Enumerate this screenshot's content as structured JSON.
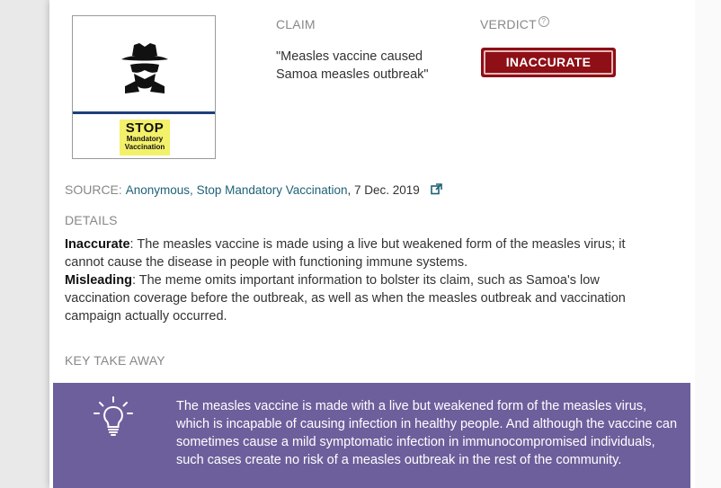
{
  "image": {
    "stop_word": "STOP",
    "stop_line1": "Mandatory",
    "stop_line2": "Vaccination",
    "icon": "spy-icon"
  },
  "claim": {
    "label": "CLAIM",
    "text": "\"Measles vaccine caused Samoa measles outbreak\""
  },
  "verdict": {
    "label": "VERDICT",
    "help_icon": "?",
    "value": "INACCURATE",
    "color": "#8e0f16"
  },
  "source": {
    "label": "SOURCE:",
    "link1": "Anonymous",
    "separator": ",",
    "link2": "Stop Mandatory Vaccination",
    "date": ", 7 Dec. 2019"
  },
  "details": {
    "label": "DETAILS",
    "items": [
      {
        "term": "Inaccurate",
        "text": ": The measles vaccine is made using a live but weakened form of the measles virus; it cannot cause the disease in people with functioning immune systems."
      },
      {
        "term": "Misleading",
        "text": ": The meme omits important information to bolster its claim, such as Samoa's low vaccination coverage before the outbreak, as well as when the measles outbreak and vaccination campaign actually occurred."
      }
    ]
  },
  "key_takeaway": {
    "label": "KEY TAKE AWAY",
    "text": "The measles vaccine is made with a live but weakened form of the measles virus, which is incapable of causing infection in healthy people. And although the vaccine can sometimes cause a mild symptomatic infection in immunocompromised individuals, such cases create no risk of a measles outbreak in the rest of the community.",
    "background": "#6d5f9c",
    "icon": "lightbulb-icon"
  }
}
